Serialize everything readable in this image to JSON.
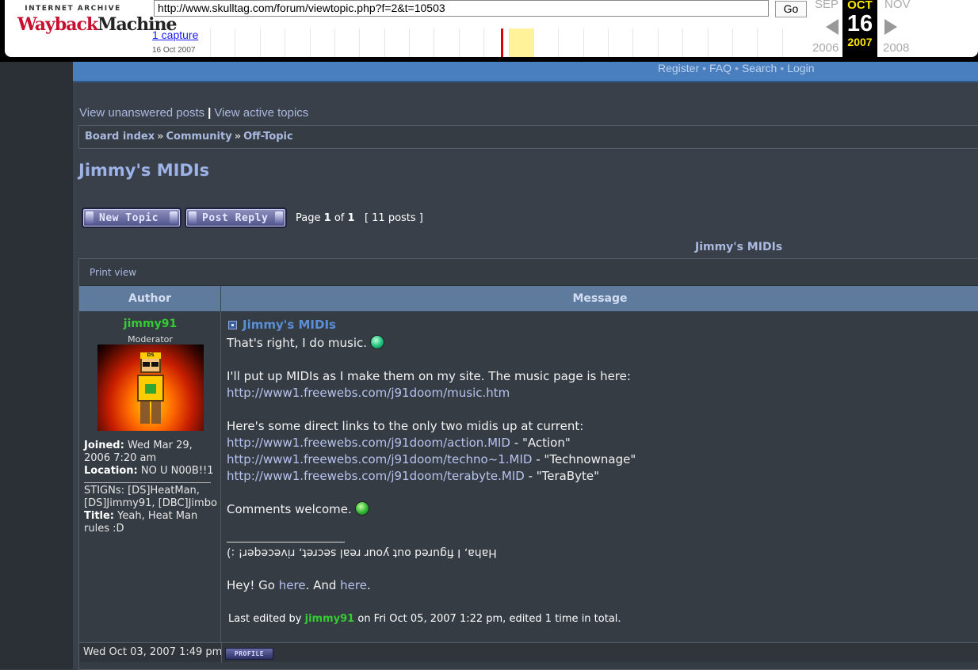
{
  "wayback": {
    "logo_top": "INTERNET ARCHIVE",
    "logo_main_a": "Wayback",
    "logo_main_b": "Machine",
    "url": "http://www.skulltag.com/forum/viewtopic.php?f=2&t=10503",
    "go_label": "Go",
    "captures_label": "1 capture",
    "capture_date": "16 Oct 2007",
    "prev_month": "SEP",
    "current_month": "OCT",
    "next_month": "NOV",
    "current_day": "16",
    "prev_year": "2006",
    "current_year": "2007",
    "next_year": "2008"
  },
  "topnav": {
    "register": "Register",
    "faq": "FAQ",
    "search": "Search",
    "login": "Login",
    "separator": "•"
  },
  "view_links": {
    "unanswered": "View unanswered posts",
    "separator": "|",
    "active": "View active topics"
  },
  "breadcrumb": {
    "items": [
      "Board index",
      "Community",
      "Off-Topic"
    ],
    "separator": "»"
  },
  "page": {
    "title": "Jimmy's MIDIs",
    "new_topic": "New Topic",
    "post_reply": "Post Reply",
    "page_word": "Page",
    "page_current": "1",
    "of_word": "of",
    "page_total": "1",
    "post_count": "[ 11 posts ]",
    "topic_heading": "Jimmy's MIDIs",
    "print_view": "Print view"
  },
  "table": {
    "author_header": "Author",
    "message_header": "Message"
  },
  "post": {
    "author": "jimmy91",
    "rank": "Moderator",
    "avatar_badge": "DS",
    "joined_label": "Joined:",
    "joined_value": "Wed Mar 29, 2006 7:20 am",
    "location_label": "Location:",
    "location_value": "NO U N00B!!1",
    "stigns": "STIGNs: [DS]HeatMan, [DS]Jimmy91, [DBC]Jimbo",
    "title_label": "Title:",
    "title_value": "Yeah, Heat Man rules :D",
    "subject": "Jimmy's MIDIs",
    "line1": "That's right, I do music.",
    "line2": "I'll put up MIDIs as I make them on my site. The music page is here:",
    "link_music": "http://www1.freewebs.com/j91doom/music.htm",
    "line3": "Here's some direct links to the only two midis up at current:",
    "links": [
      {
        "url": "http://www1.freewebs.com/j91doom/action.MID",
        "label": " - \"Action\""
      },
      {
        "url": "http://www1.freewebs.com/j91doom/techno~1.MID",
        "label": " - \"Technownage\""
      },
      {
        "url": "http://www1.freewebs.com/j91doom/terabyte.MID",
        "label": " - \"TeraByte\""
      }
    ],
    "line4": "Comments welcome.",
    "sig_flipped": "Haha, I figured out your real secret, riveceqer! :)",
    "sig_hey": "Hey! Go",
    "sig_here1": "here",
    "sig_and": ". And",
    "sig_here2": "here",
    "sig_end": ".",
    "edited_prefix": "Last edited by",
    "edited_user": "jimmy91",
    "edited_suffix": "on Fri Oct 05, 2007 1:22 pm, edited 1 time in total.",
    "date": "Wed Oct 03, 2007 1:49 pm",
    "profile_label": "PROFILE"
  },
  "colors": {
    "background": "#3a4049",
    "nav_blue": "#4a7fbf",
    "link": "#aab9e0",
    "username_green": "#33cc33",
    "table_header": "#5e7a9c"
  }
}
